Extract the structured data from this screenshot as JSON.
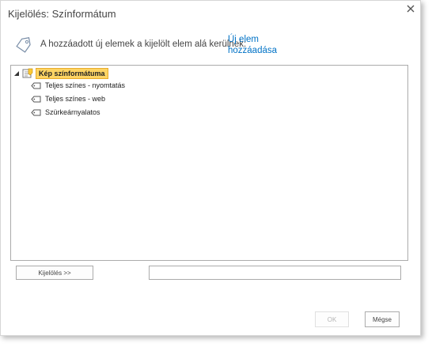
{
  "dialog": {
    "title": "Kijelölés: Színformátum",
    "info_text": "A hozzáadott új elemek a kijelölt elem alá kerülnek:",
    "add_link": "Új elem hozzáadása"
  },
  "tree": {
    "root": {
      "label": "Kép színformátuma",
      "expanded": true,
      "selected": true
    },
    "items": [
      {
        "label": "Teljes színes - nyomtatás"
      },
      {
        "label": "Teljes színes - web"
      },
      {
        "label": "Szürkeárnyalatos"
      }
    ]
  },
  "footer": {
    "select_button": "Kijelölés >>",
    "selection_value": "",
    "ok_button": "OK",
    "cancel_button": "Mégse"
  },
  "colors": {
    "link": "#0072c6",
    "selected_bg": "#fdd463",
    "selected_border": "#e8ac2a"
  }
}
